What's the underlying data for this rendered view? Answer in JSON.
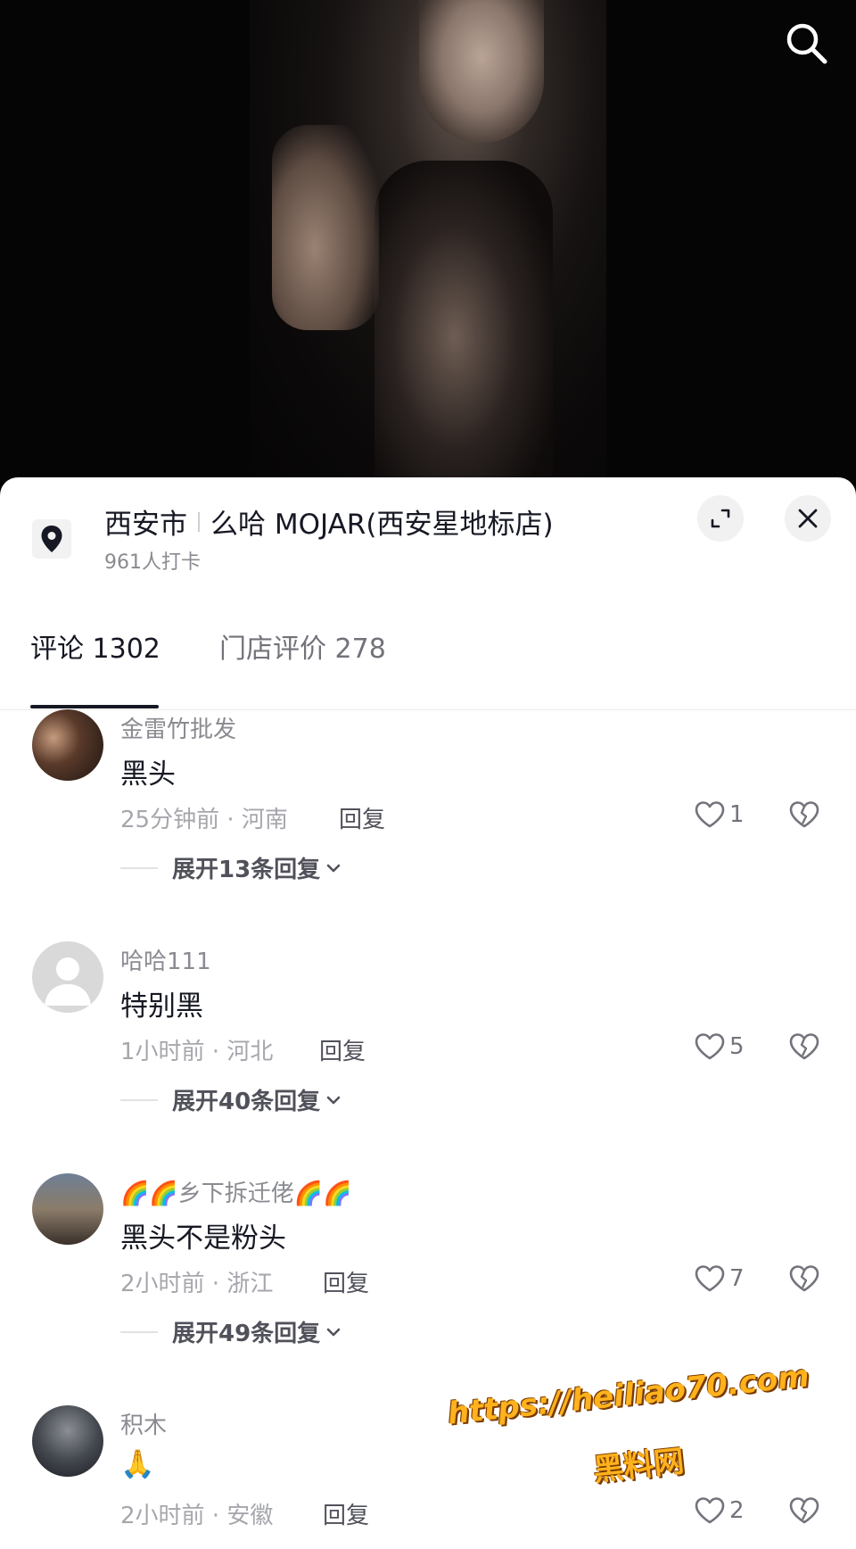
{
  "location": {
    "city": "西安市",
    "store": "么哈 MOJAR(西安星地标店)",
    "checkins": "961人打卡"
  },
  "tabs": [
    {
      "label": "评论 1302"
    },
    {
      "label": "门店评价 278"
    }
  ],
  "reply_label": "回复",
  "comments": [
    {
      "user": "金雷竹批发",
      "text": "黑头",
      "meta": "25分钟前 · 河南",
      "likes": "1",
      "expand": "展开13条回复"
    },
    {
      "user": "哈哈111",
      "text": "特别黑",
      "meta": "1小时前 · 河北",
      "likes": "5",
      "expand": "展开40条回复"
    },
    {
      "user": "🌈🌈乡下拆迁佬🌈🌈",
      "text": "黑头不是粉头",
      "meta": "2小时前 · 浙江",
      "likes": "7",
      "expand": "展开49条回复"
    },
    {
      "user": "积木",
      "text": "🙏",
      "meta": "2小时前 · 安徽",
      "likes": "2"
    }
  ],
  "watermark": {
    "url": "https://heiliao70.com",
    "name": "黑料网"
  },
  "colors": {
    "text_primary": "#161823",
    "text_secondary": "#8a8b91",
    "watermark": "#ffb21c"
  }
}
